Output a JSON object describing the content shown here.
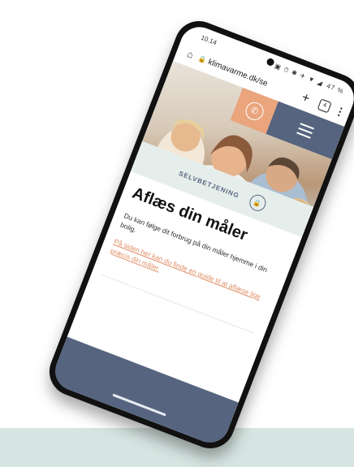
{
  "status_bar": {
    "time": "10.14",
    "icons": "▣ ⏱ ✱ ✈ ▼ ◢",
    "battery": "47 %"
  },
  "browser": {
    "url": "klimavarme.dk/se",
    "tab_count": "4"
  },
  "page": {
    "section_label": "SELVBETJENING",
    "title": "Aflæs din måler",
    "intro": "Du kan følge dit forbrug på din måler hjemme i din bolig.",
    "link_text": "På siden her kan du finde en guide til at aflæse lige præcis din måler."
  },
  "colors": {
    "accent_orange": "#eaa57d",
    "nav_blue": "#56647f",
    "band_green": "#e6eeec",
    "ground": "#d7e5e2"
  },
  "icons": [
    "home-icon",
    "lock-icon",
    "plus-icon",
    "tabs-icon",
    "menu-dots-icon",
    "phone-icon",
    "hamburger-icon",
    "lock-circle-icon"
  ]
}
